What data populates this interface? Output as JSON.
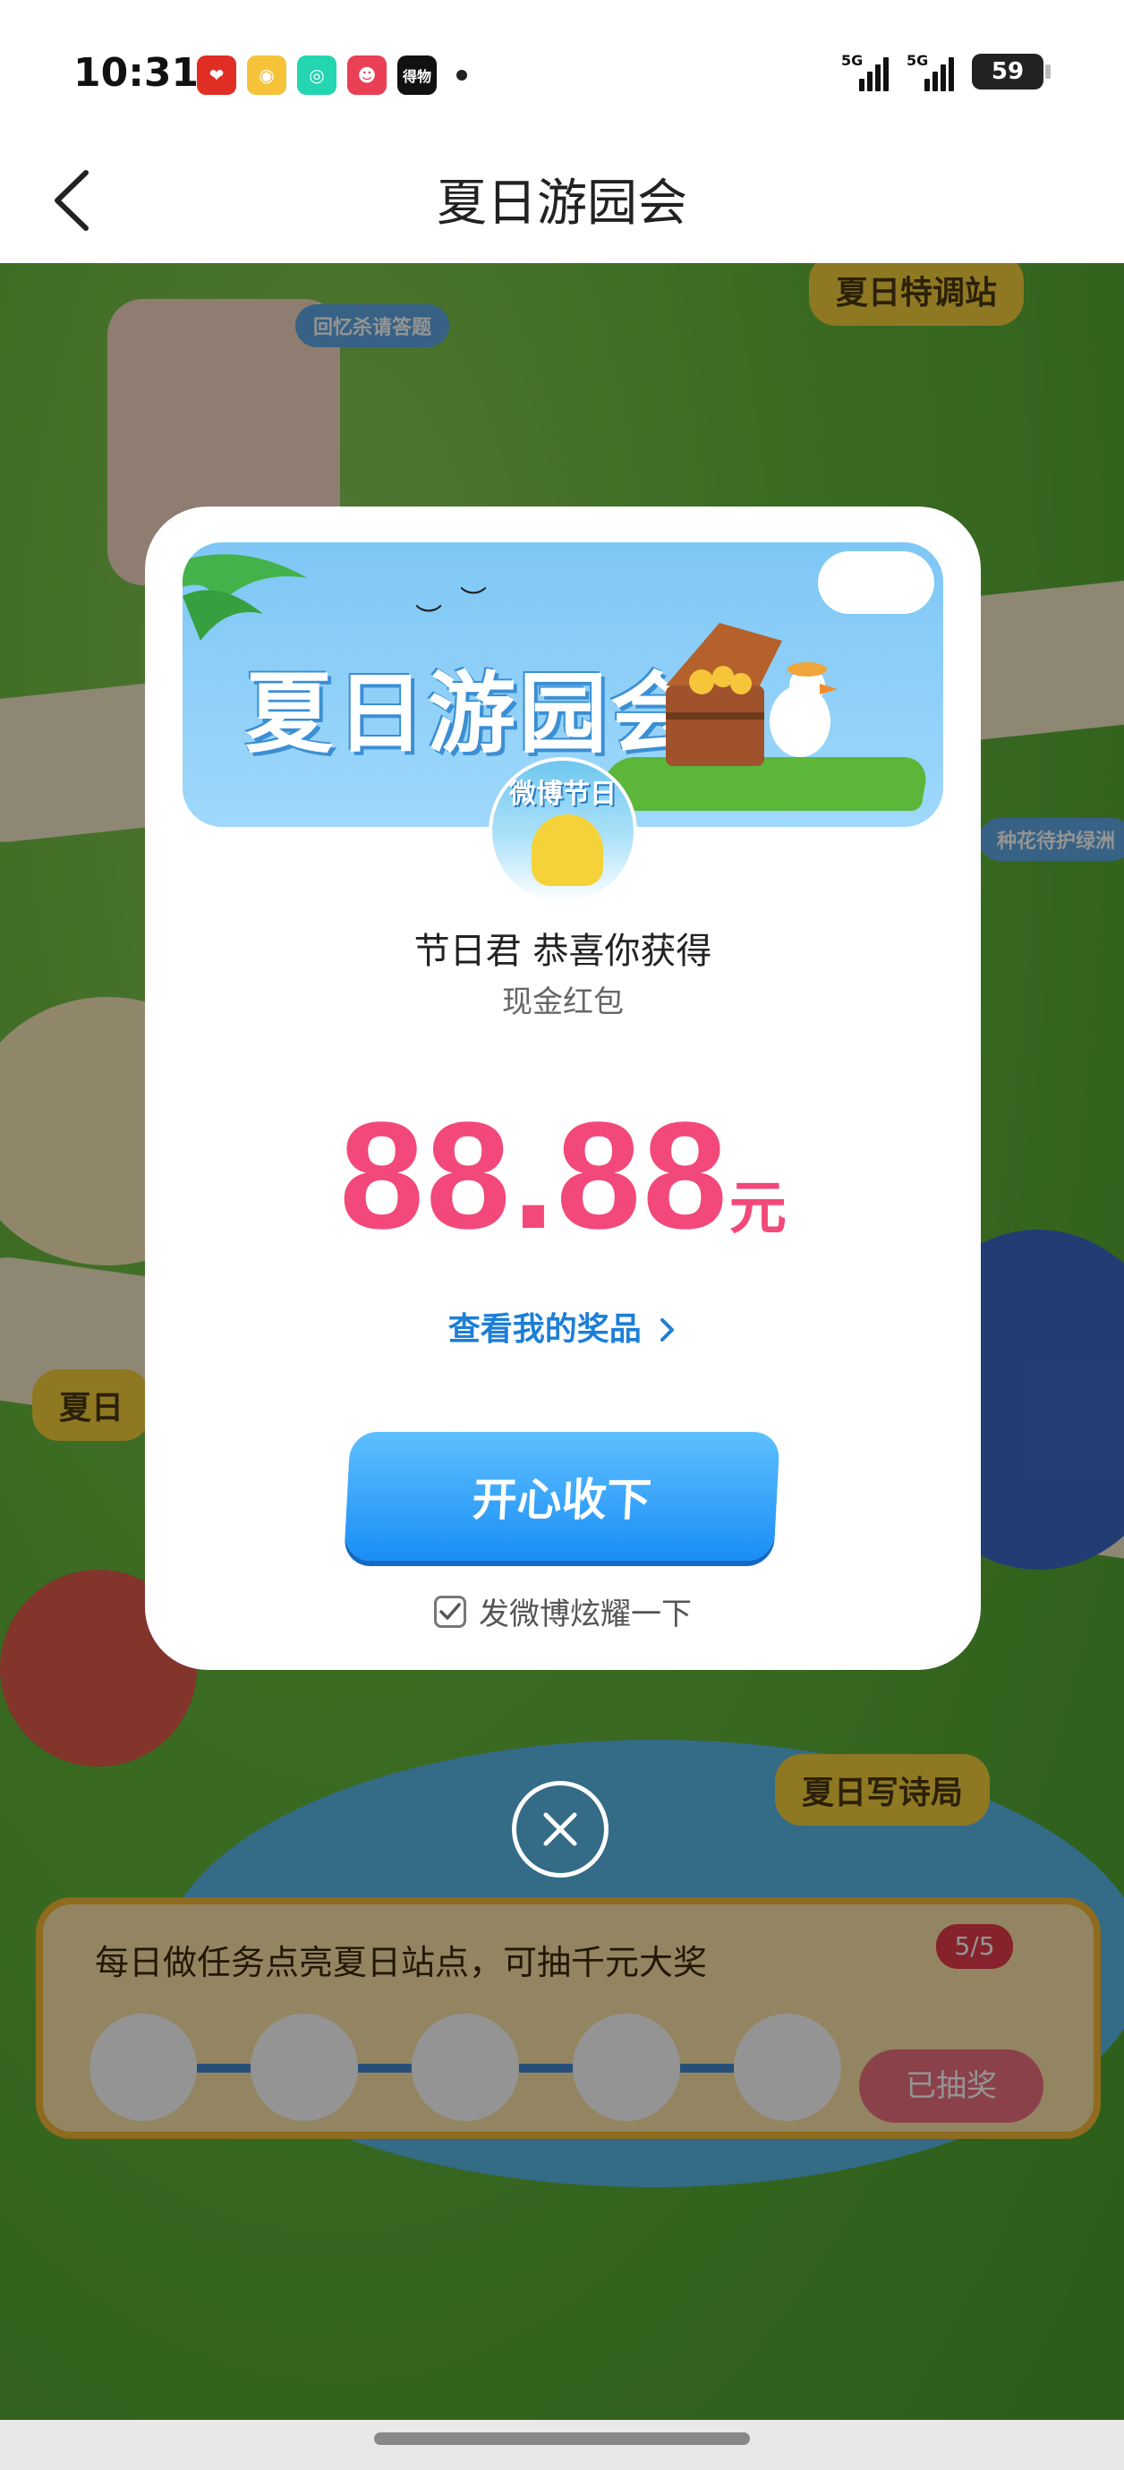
{
  "status_bar": {
    "time": "10:31",
    "network_1": "5G",
    "network_2": "5G",
    "battery": "59",
    "app_icons": [
      {
        "name": "pinduoduo-icon",
        "color": "#e02e24"
      },
      {
        "name": "weibo-icon",
        "color": "#f5a623"
      },
      {
        "name": "camera-app-icon",
        "color": "#23d5b0"
      },
      {
        "name": "game-app-icon",
        "color": "#e94056"
      },
      {
        "name": "dewu-icon",
        "color": "#111111",
        "text": "得物"
      }
    ]
  },
  "nav": {
    "title": "夏日游园会"
  },
  "background": {
    "labels": [
      "夏日特调站",
      "夏日",
      "夏日写诗局"
    ],
    "signs": [
      "回忆杀请答题",
      "种花待护绿洲"
    ],
    "task_text": "每日做任务点亮夏日站点，可抽千元大奖",
    "task_count": "5/5",
    "drawn_button": "已抽奖"
  },
  "modal": {
    "banner_title": "夏日游园会",
    "avatar_label": "微博节日",
    "congrats": "节日君 恭喜你获得",
    "prize_type": "现金红包",
    "amount": "88.88",
    "unit": "元",
    "view_prizes": "查看我的奖品",
    "accept_button": "开心收下",
    "share_label": "发微博炫耀一下",
    "share_checked": true
  },
  "colors": {
    "accent_pink": "#f2497a",
    "accent_blue": "#1d7fd6",
    "button_blue": "#1a8df5"
  }
}
